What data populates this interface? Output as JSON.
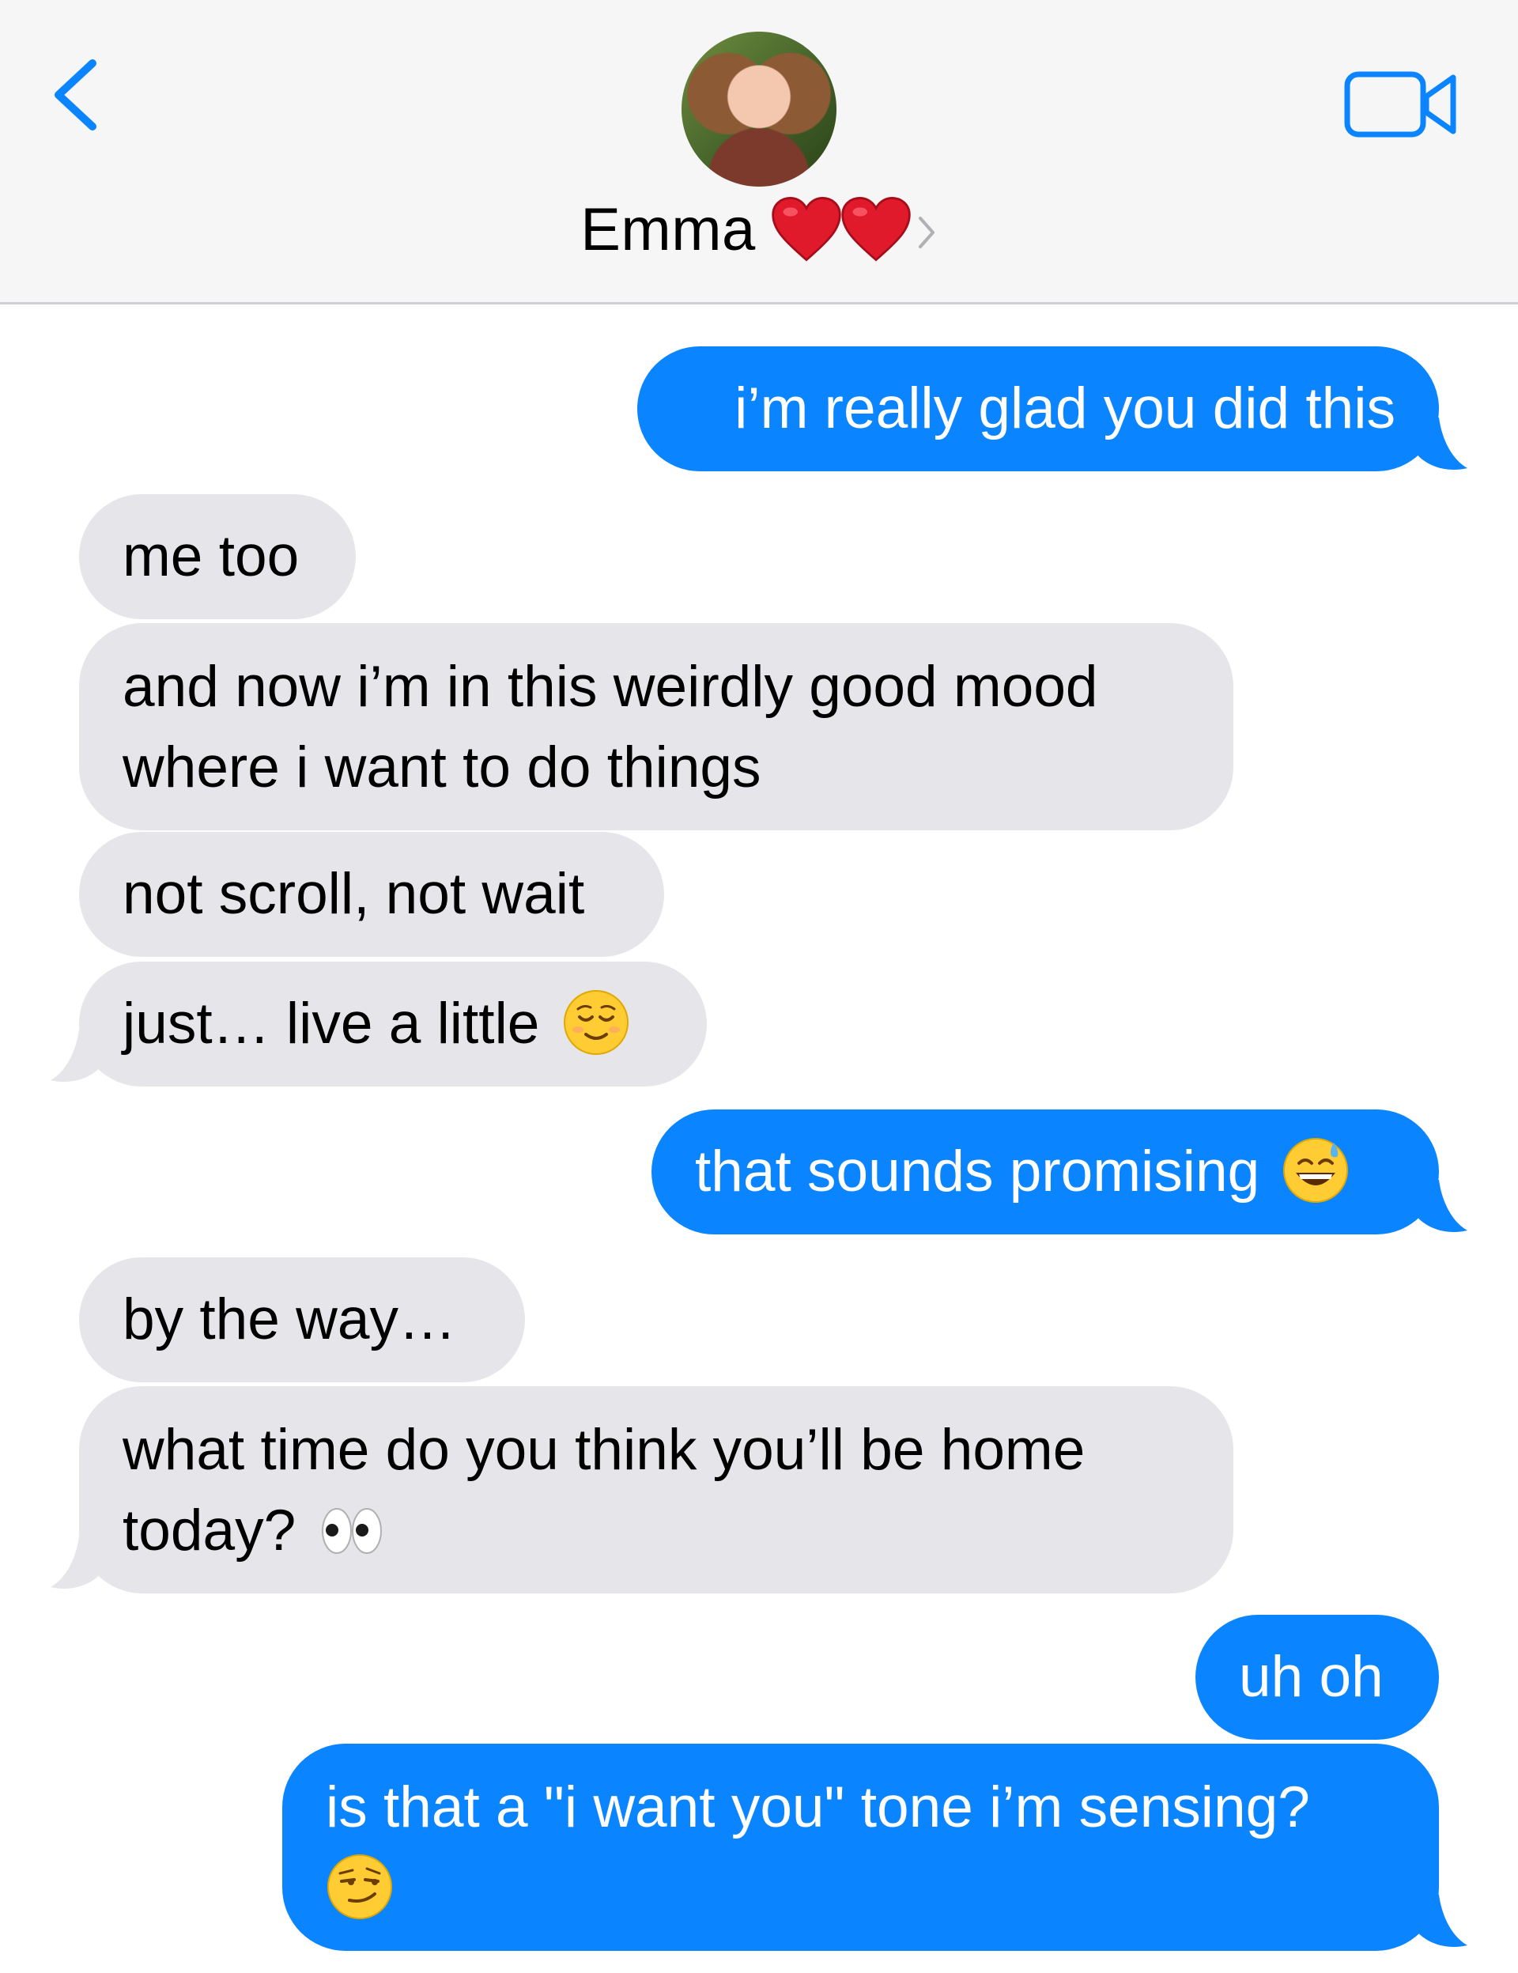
{
  "header": {
    "contact_name": "Emma",
    "back_icon": "chevron-left-icon",
    "video_icon": "video-camera-icon",
    "accent_color": "#0a84ff"
  },
  "messages": [
    {
      "from": "me",
      "text": "i’m really glad you did this"
    },
    {
      "from": "them",
      "text": "me too"
    },
    {
      "from": "them",
      "line1": "and now i’m in this weirdly good mood",
      "line2": "where i want to do things"
    },
    {
      "from": "them",
      "text": "not scroll, not wait"
    },
    {
      "from": "them",
      "text": "just… live a little",
      "emoji": "relieved-face-emoji"
    },
    {
      "from": "me",
      "text": "that sounds promising",
      "emoji": "grinning-face-with-sweat-emoji"
    },
    {
      "from": "them",
      "text": "by the way…"
    },
    {
      "from": "them",
      "line1": "what time do you think you’ll be home",
      "line2": "today?",
      "emoji": "eyes-emoji"
    },
    {
      "from": "me",
      "text": "uh oh"
    },
    {
      "from": "me",
      "line1": "is that a \"i want you\" tone i’m sensing?",
      "emoji": "smirking-face-emoji"
    }
  ],
  "colors": {
    "outgoing_bubble": "#0a84ff",
    "incoming_bubble": "#e5e5ea"
  }
}
